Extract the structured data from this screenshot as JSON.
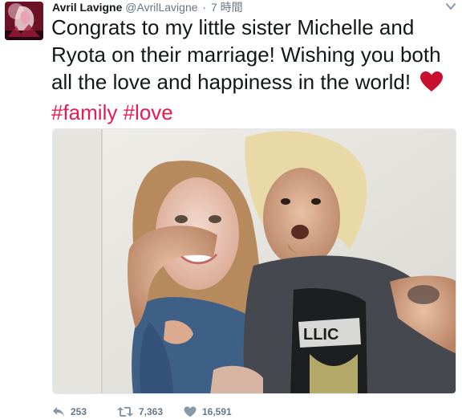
{
  "tweet": {
    "author": {
      "display_name": "Avril Lavigne",
      "handle": "@AvrilLavigne",
      "avatar_icon": "avatar-image"
    },
    "separator": "·",
    "time": "7 時間",
    "text_main": "Congrats to my little sister Michelle and Ryota on their marriage! Wishing you both all the love and happiness in the world!",
    "emoji": "❤️",
    "hashtags": [
      "#family",
      "#love"
    ],
    "media": {
      "icon": "photo-image"
    },
    "actions": {
      "reply_count": "253",
      "retweet_count": "7,363",
      "like_count": "16,591"
    },
    "colors": {
      "hashtag": "#e81c4f",
      "muted": "#657786",
      "text": "#14171a",
      "heart": "#d0021b"
    }
  }
}
